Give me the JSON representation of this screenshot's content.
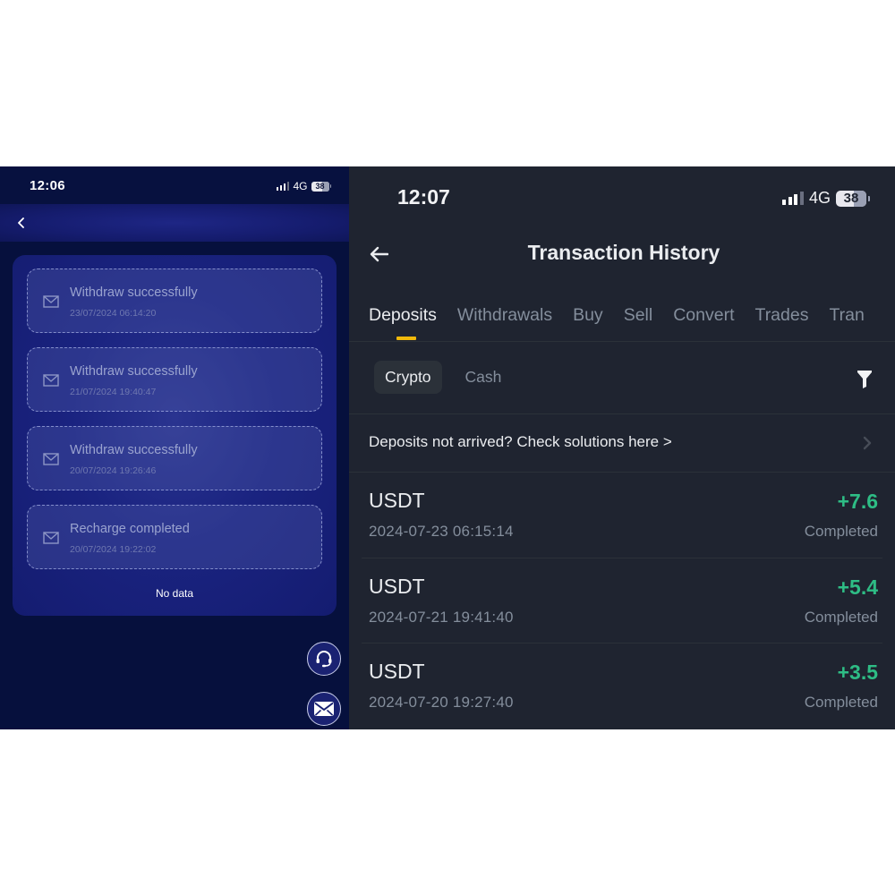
{
  "left_screen": {
    "status_bar": {
      "time": "12:06",
      "network": "4G",
      "battery": "38"
    },
    "messages": [
      {
        "title": "Withdraw successfully",
        "timestamp": "23/07/2024 06:14:20",
        "icon": "mail-icon"
      },
      {
        "title": "Withdraw successfully",
        "timestamp": "21/07/2024 19:40:47",
        "icon": "mail-icon"
      },
      {
        "title": "Withdraw successfully",
        "timestamp": "20/07/2024 19:26:46",
        "icon": "mail-icon"
      },
      {
        "title": "Recharge completed",
        "timestamp": "20/07/2024 19:22:02",
        "icon": "mail-icon"
      }
    ],
    "empty_text": "No data",
    "floating_buttons": [
      "headset-icon",
      "mail-icon"
    ]
  },
  "right_screen": {
    "status_bar": {
      "time": "12:07",
      "network": "4G",
      "battery": "38"
    },
    "header": {
      "title": "Transaction History"
    },
    "tabs": [
      {
        "label": "Deposits",
        "active": true
      },
      {
        "label": "Withdrawals",
        "active": false
      },
      {
        "label": "Buy",
        "active": false
      },
      {
        "label": "Sell",
        "active": false
      },
      {
        "label": "Convert",
        "active": false
      },
      {
        "label": "Trades",
        "active": false
      },
      {
        "label": "Tran",
        "active": false
      }
    ],
    "segments": [
      {
        "label": "Crypto",
        "active": true
      },
      {
        "label": "Cash",
        "active": false
      }
    ],
    "notice": "Deposits not arrived? Check solutions here >",
    "transactions": [
      {
        "coin": "USDT",
        "datetime": "2024-07-23 06:15:14",
        "amount": "+7.6",
        "status": "Completed"
      },
      {
        "coin": "USDT",
        "datetime": "2024-07-21 19:41:40",
        "amount": "+5.4",
        "status": "Completed"
      },
      {
        "coin": "USDT",
        "datetime": "2024-07-20 19:27:40",
        "amount": "+3.5",
        "status": "Completed"
      }
    ],
    "colors": {
      "accent": "#f0b90b",
      "positive": "#2ebd85",
      "background": "#1f2430"
    }
  }
}
